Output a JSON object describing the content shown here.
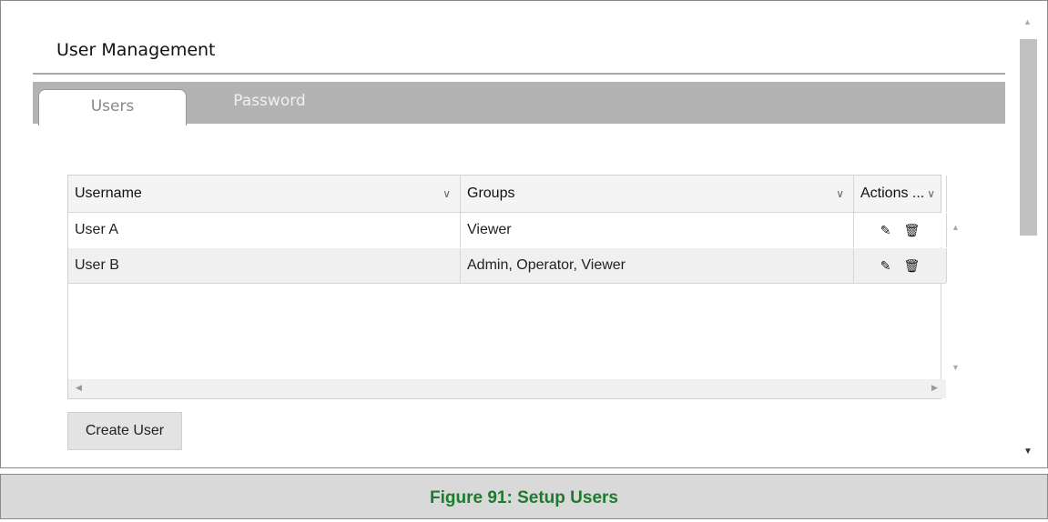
{
  "panel": {
    "title": "User Management"
  },
  "tabs": [
    {
      "label": "Users",
      "active": true
    },
    {
      "label": "Password",
      "active": false
    }
  ],
  "grid": {
    "columns": [
      {
        "label": "Username",
        "sort_icon": "chevron-down-icon"
      },
      {
        "label": "Groups",
        "sort_icon": "chevron-down-icon"
      },
      {
        "label": "Actions ...",
        "sort_icon": "chevron-down-icon"
      }
    ],
    "rows": [
      {
        "username": "User A",
        "groups": "Viewer",
        "actions": [
          "edit-pencil-icon",
          "delete-trash-icon"
        ]
      },
      {
        "username": "User B",
        "groups": "Admin, Operator, Viewer",
        "actions": [
          "edit-pencil-icon",
          "delete-trash-icon"
        ]
      }
    ]
  },
  "buttons": {
    "create_user": "Create User"
  },
  "caption": "Figure 91: Setup Users",
  "colors": {
    "tab_bar": "#b3b3b3",
    "caption_text": "#1e7b2e",
    "caption_bg": "#d9d9d9"
  }
}
